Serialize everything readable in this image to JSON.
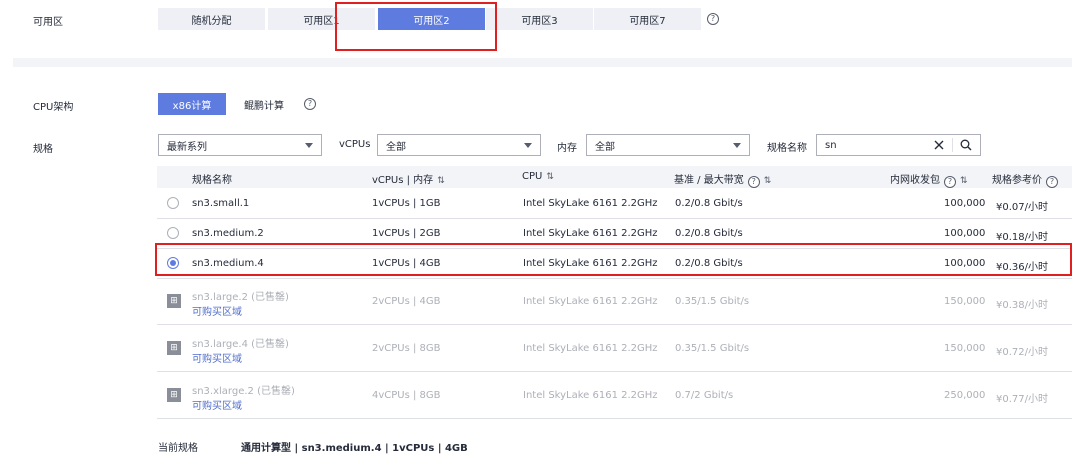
{
  "az": {
    "label": "可用区",
    "tabs": [
      "随机分配",
      "可用区1",
      "可用区2",
      "可用区3",
      "可用区7"
    ],
    "active_index": 2
  },
  "cpu_arch": {
    "label": "CPU架构",
    "options": [
      "x86计算",
      "鲲鹏计算"
    ],
    "active_index": 0
  },
  "spec": {
    "label": "规格",
    "series_value": "最新系列",
    "vcpus_label": "vCPUs",
    "vcpus_value": "全部",
    "mem_label": "内存",
    "mem_value": "全部",
    "name_label": "规格名称",
    "search_value": "sn"
  },
  "table": {
    "headers": [
      "规格名称",
      "vCPUs | 内存",
      "CPU",
      "基准 / 最大带宽",
      "内网收发包",
      "规格参考价"
    ],
    "rows": [
      {
        "name": "sn3.small.1",
        "vcpus": "1vCPUs | 1GB",
        "cpu": "Intel SkyLake 6161 2.2GHz",
        "bw": "0.2/0.8 Gbit/s",
        "pps": "100,000",
        "price": "¥0.07/小时",
        "status": "available",
        "selected": false
      },
      {
        "name": "sn3.medium.2",
        "vcpus": "1vCPUs | 2GB",
        "cpu": "Intel SkyLake 6161 2.2GHz",
        "bw": "0.2/0.8 Gbit/s",
        "pps": "100,000",
        "price": "¥0.18/小时",
        "status": "available",
        "selected": false
      },
      {
        "name": "sn3.medium.4",
        "vcpus": "1vCPUs | 4GB",
        "cpu": "Intel SkyLake 6161 2.2GHz",
        "bw": "0.2/0.8 Gbit/s",
        "pps": "100,000",
        "price": "¥0.36/小时",
        "status": "available",
        "selected": true
      },
      {
        "name": "sn3.large.2 (已售罄)",
        "link": "可购买区域",
        "vcpus": "2vCPUs | 4GB",
        "cpu": "Intel SkyLake 6161 2.2GHz",
        "bw": "0.35/1.5 Gbit/s",
        "pps": "150,000",
        "price": "¥0.38/小时",
        "status": "soldout"
      },
      {
        "name": "sn3.large.4 (已售罄)",
        "link": "可购买区域",
        "vcpus": "2vCPUs | 8GB",
        "cpu": "Intel SkyLake 6161 2.2GHz",
        "bw": "0.35/1.5 Gbit/s",
        "pps": "150,000",
        "price": "¥0.72/小时",
        "status": "soldout"
      },
      {
        "name": "sn3.xlarge.2 (已售罄)",
        "link": "可购买区域",
        "vcpus": "4vCPUs | 8GB",
        "cpu": "Intel SkyLake 6161 2.2GHz",
        "bw": "0.7/2 Gbit/s",
        "pps": "250,000",
        "price": "¥0.77/小时",
        "status": "soldout"
      }
    ]
  },
  "footer": {
    "label": "当前规格",
    "value": "通用计算型 | sn3.medium.4 | 1vCPUs | 4GB"
  },
  "icons": {
    "help": "help-circle-icon",
    "sort": "sort-icon",
    "clear": "close-icon",
    "search": "search-icon",
    "cart": "cart-icon"
  },
  "colors": {
    "accent": "#5e7ce0",
    "highlight_border": "#e02020",
    "link": "#526ecc"
  }
}
